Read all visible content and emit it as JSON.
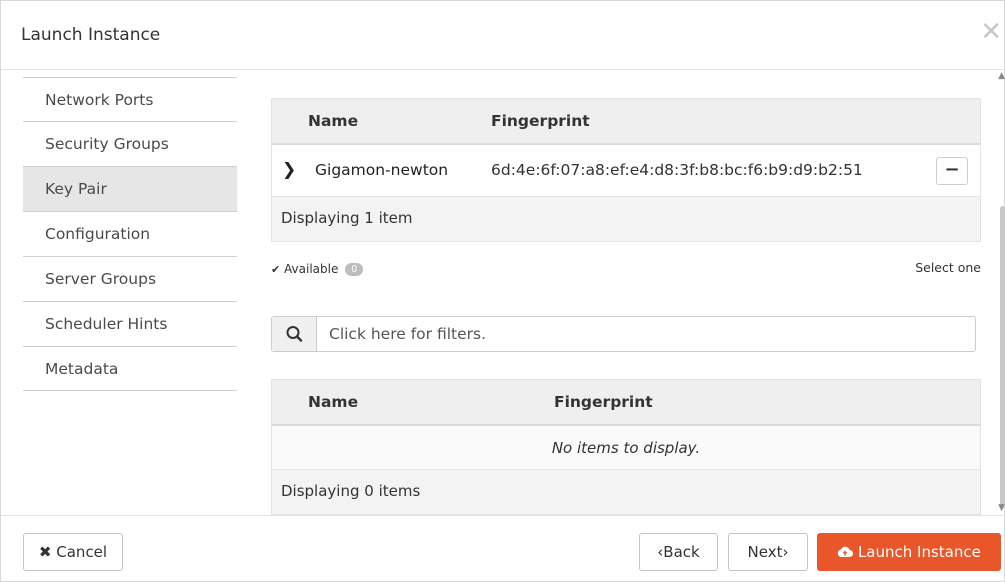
{
  "modal": {
    "title": "Launch Instance",
    "close_icon": "close-icon"
  },
  "sidebar": {
    "items": [
      {
        "label": "Network Ports"
      },
      {
        "label": "Security Groups"
      },
      {
        "label": "Key Pair",
        "active": true
      },
      {
        "label": "Configuration"
      },
      {
        "label": "Server Groups"
      },
      {
        "label": "Scheduler Hints"
      },
      {
        "label": "Metadata"
      }
    ]
  },
  "allocated": {
    "headers": {
      "name": "Name",
      "fingerprint": "Fingerprint"
    },
    "rows": [
      {
        "name": "Gigamon-newton",
        "fingerprint": "6d:4e:6f:07:a8:ef:e4:d8:3f:b8:bc:f6:b9:d9:b2:51",
        "action_icon": "minus-icon"
      }
    ],
    "footer": "Displaying 1 item"
  },
  "available": {
    "label": "Available",
    "count": "0",
    "hint": "Select one",
    "filter_placeholder": "Click here for filters.",
    "headers": {
      "name": "Name",
      "fingerprint": "Fingerprint"
    },
    "empty_message": "No items to display.",
    "footer": "Displaying 0 items"
  },
  "footer": {
    "cancel_label": "Cancel",
    "back_label": "Back",
    "next_label": "Next",
    "launch_label": "Launch Instance"
  },
  "colors": {
    "launch_button": "#e8562a",
    "active_nav": "#e6e6e6"
  }
}
